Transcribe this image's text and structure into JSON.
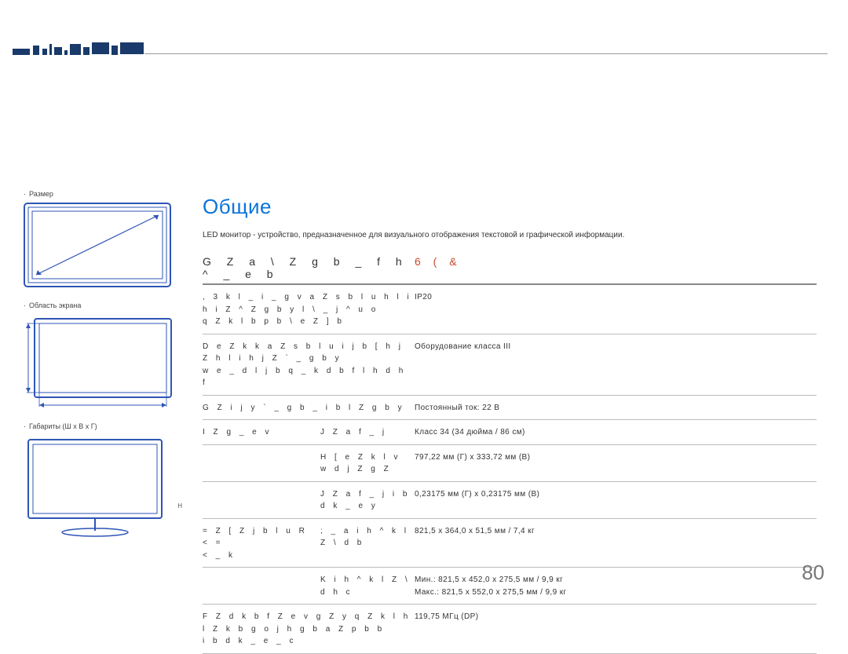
{
  "sidebar": {
    "size_label": "Размер",
    "screen_area_label": "Область экрана",
    "dimensions_label": "Габариты (Ш х В х Г)"
  },
  "main": {
    "title": "Общие",
    "intro": "LED монитор - устройство, предназначенное для визуального отображения текстовой и графической информации.",
    "model_name_label": "G Z a \\ Z g b _  f h ^ _ e b",
    "model_name_value": "6   (   &"
  },
  "specs": [
    {
      "c1": ", 3  k l _ i _ g v  a Z s b l u  h l  i h i Z ^ Z g b y  l \\ _ j ^ u o\nq Z k l b p  b  \\ e Z ] b",
      "c2": "",
      "c3": "IP20"
    },
    {
      "c1": "D e Z k k  a Z s b l u  i j b [ h j Z  h l  i h j Z ` _ g b y\nw e _ d l j b q _ k d b f  l h d h f",
      "c2": "",
      "c3": "Оборудование класса III"
    },
    {
      "c1": "G Z i j y ` _ g b _  i b l Z g b y",
      "c2": "",
      "c3": "Постоянный ток: 22 В"
    },
    {
      "c1": "I Z g _ e v",
      "c2": "J Z a f _ j",
      "c3": "Класс 34 (34 дюйма / 86 см)"
    },
    {
      "c1": "",
      "c2": "H [ e Z k l v  w d j Z g Z",
      "c3": "797,22 мм (Г) x 333,72 мм (В)"
    },
    {
      "c1": "",
      "c2": "J Z a f _ j  i b d k _ e y",
      "c3": "0,23175 мм (Г) x 0,23175 мм (В)"
    },
    {
      "c1": "= Z [ Z j b l u  R  <  =\n< _ k",
      "c2": "; _ a  i h ^ k l Z \\ d b",
      "c3": "821,5 x 364,0 x 51,5 мм / 7,4 кг"
    },
    {
      "c1": "",
      "c2": "K  i h ^ k l Z \\ d h c",
      "c3": "Мин.:  821,5 x 452,0 x 275,5 мм / 9,9 кг\nМакс.: 821,5 x 552,0 x 275,5 мм / 9,9 кг"
    },
    {
      "c1": "F Z d k b f Z e v g Z y  q Z k l h l Z  k b g o j h g b a Z p b b\ni b d k _ e _ c",
      "c2": "",
      "c3": "119,75 МГц (DP)"
    }
  ],
  "page_number": "80",
  "h_mark": "H"
}
